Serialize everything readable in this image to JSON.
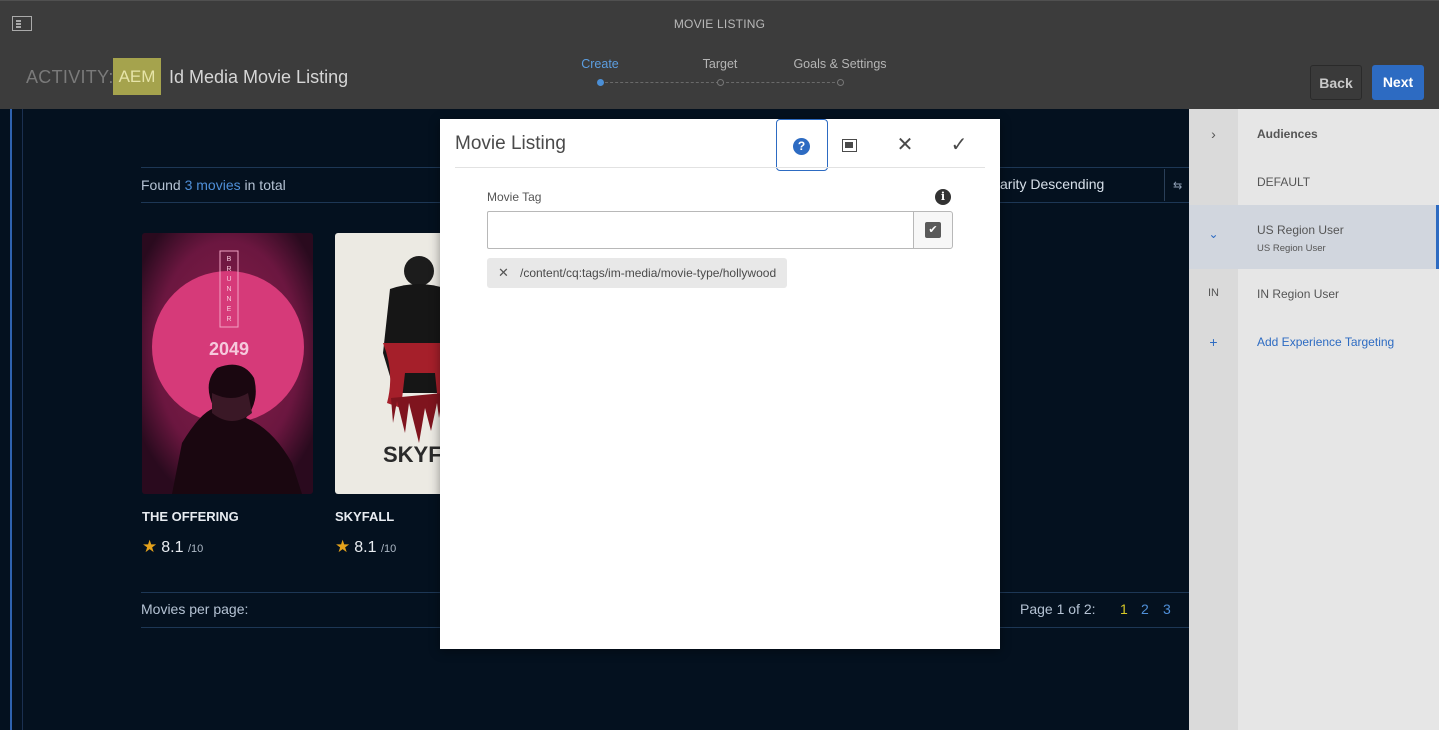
{
  "header": {
    "page_title": "MOVIE LISTING",
    "activity_label": "ACTIVITY:",
    "badge": "AEM",
    "activity_name": "Id Media Movie Listing",
    "steps": [
      {
        "label": "Create",
        "active": true
      },
      {
        "label": "Target",
        "active": false
      },
      {
        "label": "Goals & Settings",
        "active": false
      }
    ],
    "back_label": "Back",
    "next_label": "Next"
  },
  "listing": {
    "found_prefix": "Found",
    "found_count": "3 movies",
    "found_suffix": "in total",
    "sort_label": "arity Descending",
    "sort_icon": "⇆",
    "movies": [
      {
        "title": "THE OFFERING",
        "rating": "8.1",
        "scale": "/10",
        "poster_text": "2049",
        "poster_vertical": "BRUNNER"
      },
      {
        "title": "SKYFALL",
        "rating": "8.1",
        "scale": "/10",
        "poster_text": "SKYFAL"
      }
    ],
    "per_page_label": "Movies per page:",
    "page_of": "Page 1 of 2:",
    "pages": [
      "1",
      "2",
      "3"
    ]
  },
  "right_panel": {
    "header_label": "Audiences",
    "default_label": "DEFAULT",
    "selected_label": "US Region User",
    "selected_sub": "US Region User",
    "in_code": "IN",
    "in_label": "IN Region User",
    "add_label": "Add Experience Targeting"
  },
  "dialog": {
    "title": "Movie Listing",
    "field_label": "Movie Tag",
    "input_value": "",
    "tag_value": "/content/cq:tags/im-media/movie-type/hollywood"
  },
  "colors": {
    "accent": "#2d6bc2",
    "badge": "#a5a34d",
    "star": "#e4a21c",
    "current_page": "#d8c926"
  }
}
